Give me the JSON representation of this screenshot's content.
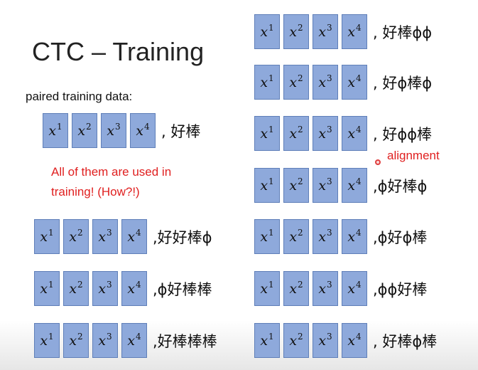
{
  "title": "CTC – Training",
  "subtitle": "paired training data:",
  "note_line1": "All of them are used in",
  "note_line2": "training! (How?!)",
  "alignment_label": "alignment",
  "box_base": "x",
  "box_sups": [
    "1",
    "2",
    "3",
    "4"
  ],
  "target": ", 好棒",
  "alignments_left": [
    ",好好棒ϕ",
    ",ϕ好棒棒",
    ",好棒棒棒"
  ],
  "alignments_right": [
    ", 好棒ϕϕ",
    ", 好ϕ棒ϕ",
    ", 好ϕϕ棒",
    ",ϕ好棒ϕ",
    ",ϕ好ϕ棒",
    ",ϕϕ好棒",
    ", 好棒ϕ棒"
  ],
  "colors": {
    "box_fill": "#8ea9db",
    "box_border": "#5f7fb8",
    "accent_red": "#e02020"
  }
}
